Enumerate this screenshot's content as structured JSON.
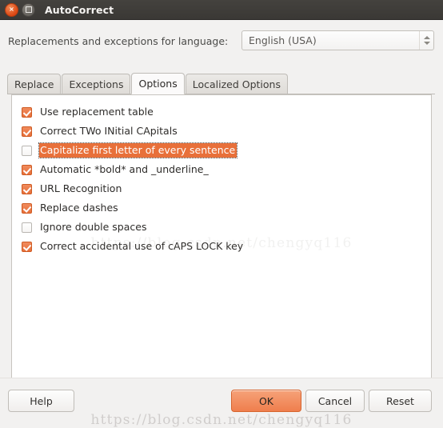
{
  "window": {
    "title": "AutoCorrect",
    "close_icon": "close-icon",
    "maximize_icon": "maximize-icon"
  },
  "language": {
    "label": "Replacements and exceptions for language:",
    "value": "English (USA)",
    "spinner_up_icon": "arrow-up-icon",
    "spinner_down_icon": "arrow-down-icon"
  },
  "tabs": [
    {
      "label": "Replace",
      "active": false
    },
    {
      "label": "Exceptions",
      "active": false
    },
    {
      "label": "Options",
      "active": true
    },
    {
      "label": "Localized Options",
      "active": false
    }
  ],
  "options": [
    {
      "label": "Use replacement table",
      "checked": true,
      "selected": false
    },
    {
      "label": "Correct TWo INitial CApitals",
      "checked": true,
      "selected": false
    },
    {
      "label": "Capitalize first letter of every sentence",
      "checked": false,
      "selected": true
    },
    {
      "label": "Automatic *bold* and _underline_",
      "checked": true,
      "selected": false
    },
    {
      "label": "URL Recognition",
      "checked": true,
      "selected": false
    },
    {
      "label": "Replace dashes",
      "checked": true,
      "selected": false
    },
    {
      "label": "Ignore double spaces",
      "checked": false,
      "selected": false
    },
    {
      "label": "Correct accidental use of cAPS LOCK key",
      "checked": true,
      "selected": false
    }
  ],
  "buttons": {
    "help": "Help",
    "ok": "OK",
    "cancel": "Cancel",
    "reset": "Reset"
  },
  "watermark": "https://blog.csdn.net/chengyq116",
  "colors": {
    "accent": "#e8703a",
    "titlebar": "#3a3835",
    "panel_bg": "#ffffff",
    "dialog_bg": "#f2f1f0"
  }
}
